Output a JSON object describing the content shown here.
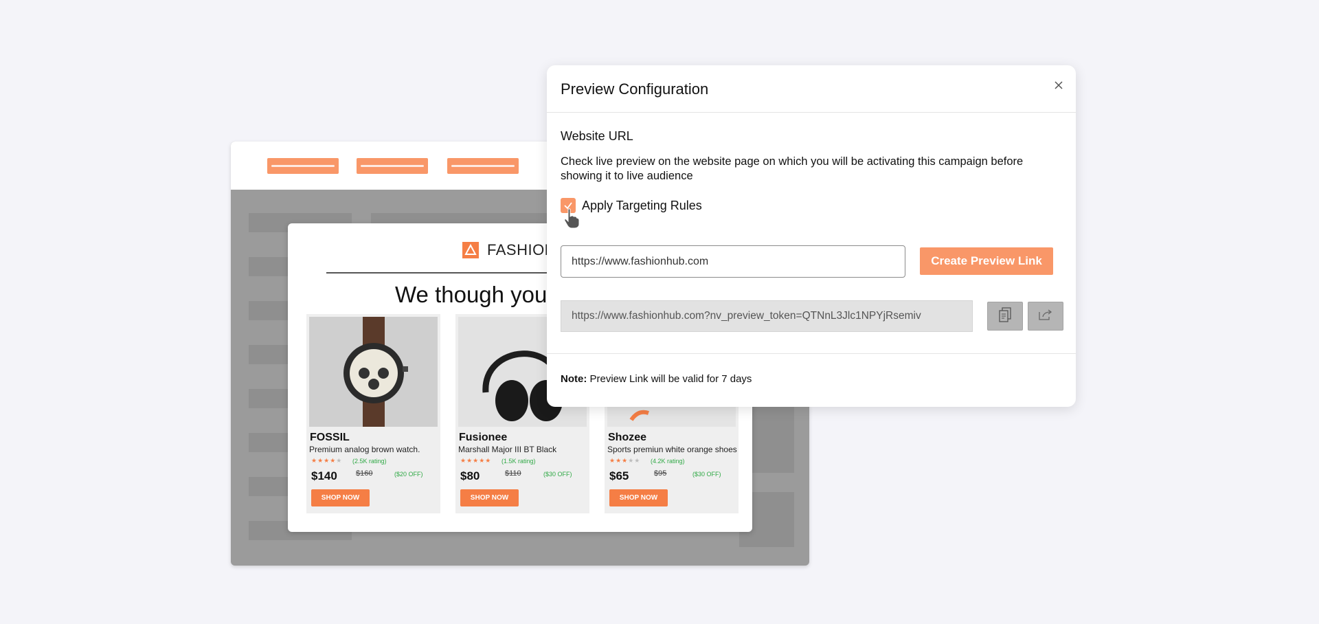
{
  "modal": {
    "title": "Preview Configuration",
    "section_title": "Website URL",
    "description": "Check live preview on the website page on which you will be activating this campaign before showing it to live audience",
    "checkbox_label": "Apply Targeting Rules",
    "checkbox_checked": true,
    "url_value": "https://www.fashionhub.com",
    "create_button": "Create Preview Link",
    "preview_link": "https://www.fashionhub.com?nv_preview_token=QTNnL3Jlc1NPYjRsemiv",
    "note_label": "Note:",
    "note_text": " Preview Link will be valid for 7 days",
    "icons": [
      "close-icon",
      "copy-icon",
      "share-icon",
      "hand-cursor-icon"
    ],
    "accent_color": "#f99768"
  },
  "site": {
    "brand": "FASHION",
    "headline": "We though you'",
    "products": [
      {
        "brand": "FOSSIL",
        "desc": "Premium analog brown watch.",
        "rating": "(2.5K rating)",
        "stars": 4,
        "price": "$140",
        "old_price": "$160",
        "off": "($20 OFF)",
        "cta": "SHOP NOW"
      },
      {
        "brand": "Fusionee",
        "desc": "Marshall Major III BT Black",
        "rating": "(1.5K rating)",
        "stars": 5,
        "price": "$80",
        "old_price": "$110",
        "off": "($30 OFF)",
        "cta": "SHOP NOW"
      },
      {
        "brand": "Shozee",
        "desc": "Sports premiun white orange shoes",
        "rating": "(4.2K rating)",
        "stars": 3,
        "price": "$65",
        "old_price": "$95",
        "off": "($30 OFF)",
        "cta": "SHOP NOW"
      }
    ]
  }
}
